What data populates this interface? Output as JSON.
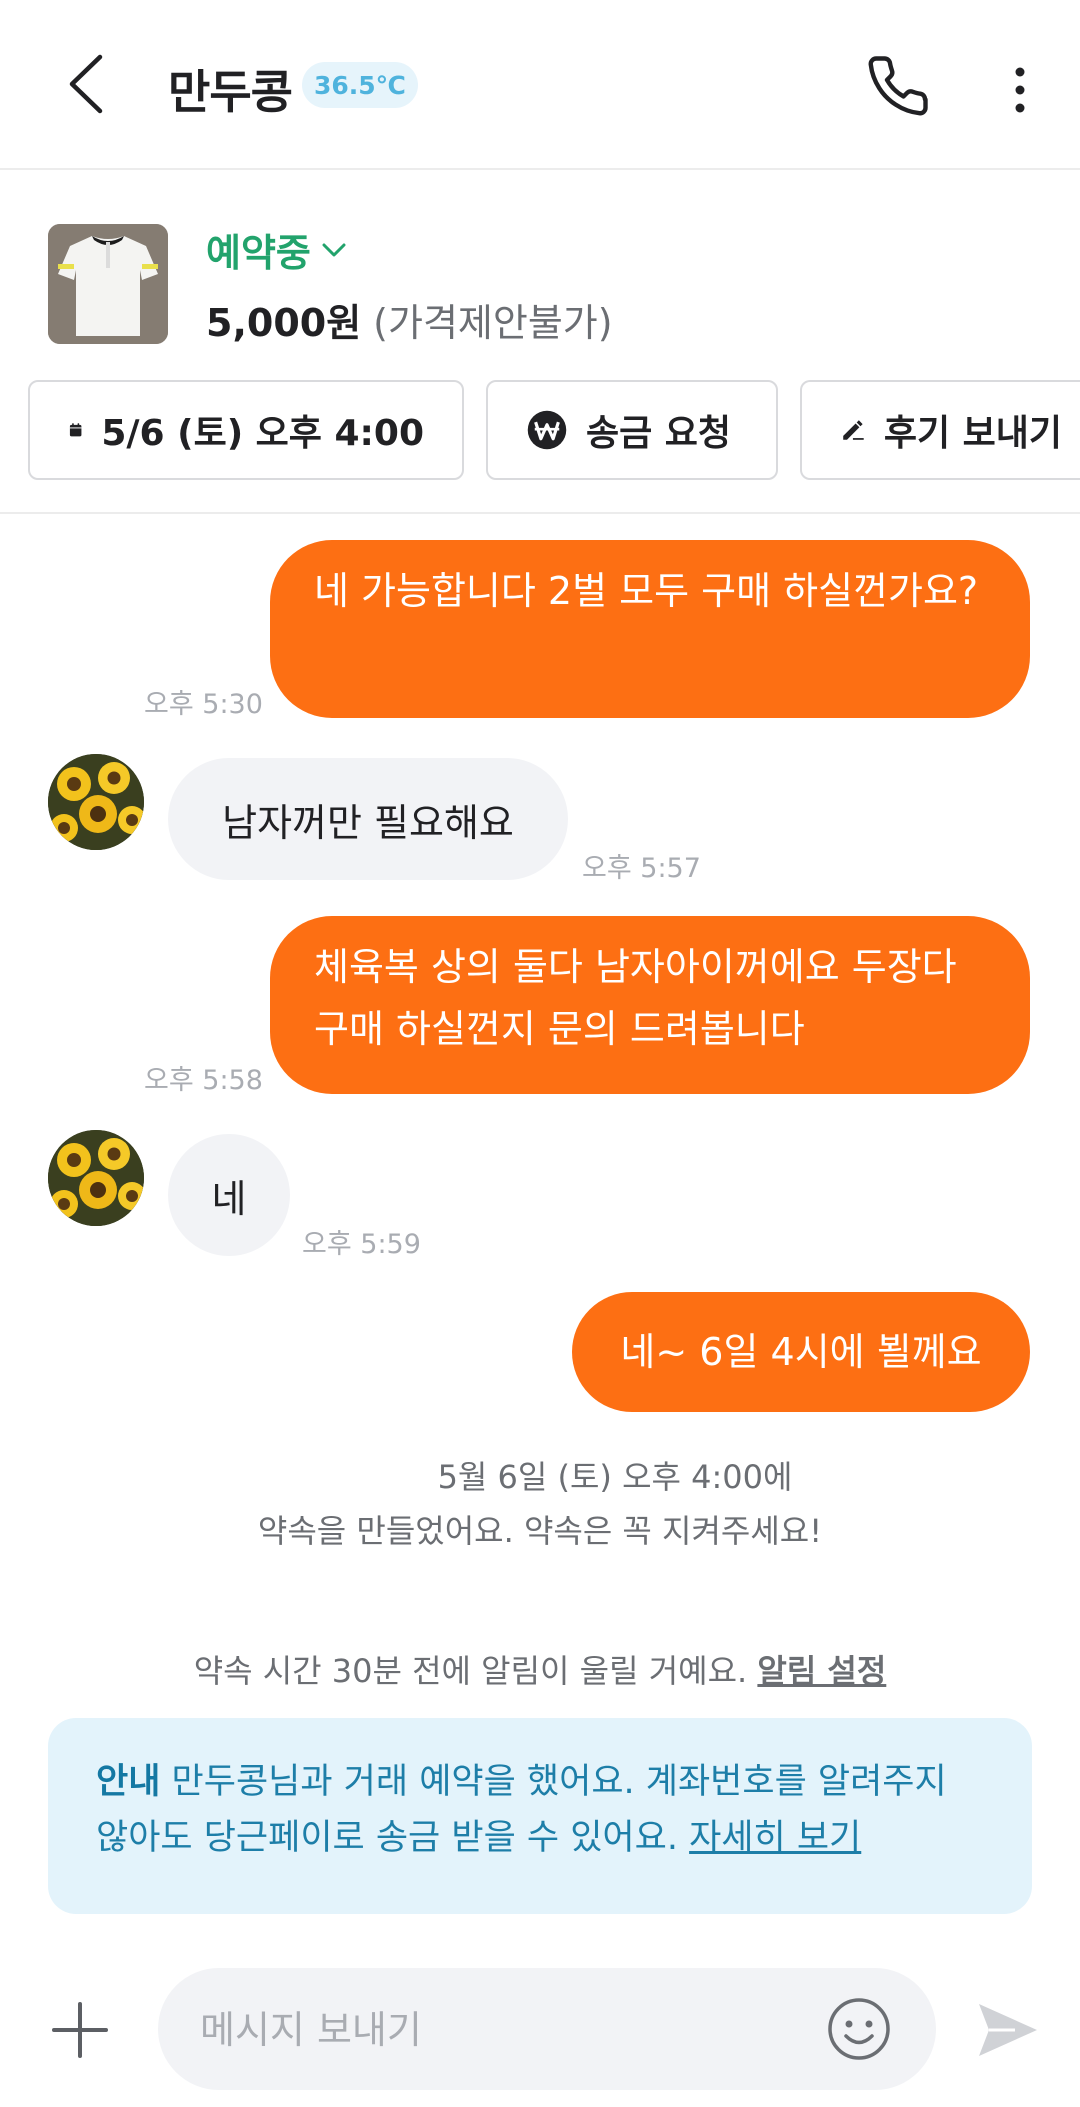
{
  "header": {
    "title": "만두콩",
    "temperature": "36.5℃"
  },
  "product": {
    "status": "예약중",
    "price": "5,000원",
    "price_note": "(가격제안불가)"
  },
  "actions": {
    "schedule_label": "5/6 (토) 오후 4:00",
    "remit_label": "송금 요청",
    "review_label": "후기 보내기"
  },
  "messages": [
    {
      "sender": "me",
      "text": "네 가능합니다 2벌 모두 구매 하실껀가요?",
      "time": "오후 5:30"
    },
    {
      "sender": "other",
      "text": "남자꺼만  필요해요",
      "time": "오후 5:57"
    },
    {
      "sender": "me",
      "text": "체육복 상의 둘다 남자아이꺼에요 두장다 구매 하실껀지 문의 드려봅니다",
      "time": "오후 5:58"
    },
    {
      "sender": "other",
      "text": "네",
      "time": "오후 5:59"
    },
    {
      "sender": "me",
      "text": "네~  6일 4시에 뵐께요",
      "time": ""
    }
  ],
  "system": {
    "appointment_line1": "5월 6일 (토) 오후 4:00에",
    "appointment_line2": "약속을 만들었어요. 약속은 꼭 지켜주세요!",
    "alarm_text": "약속 시간 30분 전에 알림이 울릴 거예요.",
    "alarm_link": "알림 설정"
  },
  "notice": {
    "label": "안내",
    "text": "만두콩님과 거래 예약을 했어요. 계좌번호를 알려주지 않아도 당근페이로 송금 받을 수 있어요.",
    "link": "자세히 보기"
  },
  "input": {
    "placeholder": "메시지 보내기"
  },
  "colors": {
    "accent": "#fd6f13",
    "status_green": "#22a36c",
    "temp_blue": "#4fb3dd",
    "notice_bg": "#e3f3fb"
  },
  "icons": [
    "back-arrow-icon",
    "phone-icon",
    "more-vertical-icon",
    "chevron-down-icon",
    "calendar-icon",
    "won-icon",
    "pencil-icon",
    "plus-icon",
    "emoji-icon",
    "send-icon"
  ]
}
